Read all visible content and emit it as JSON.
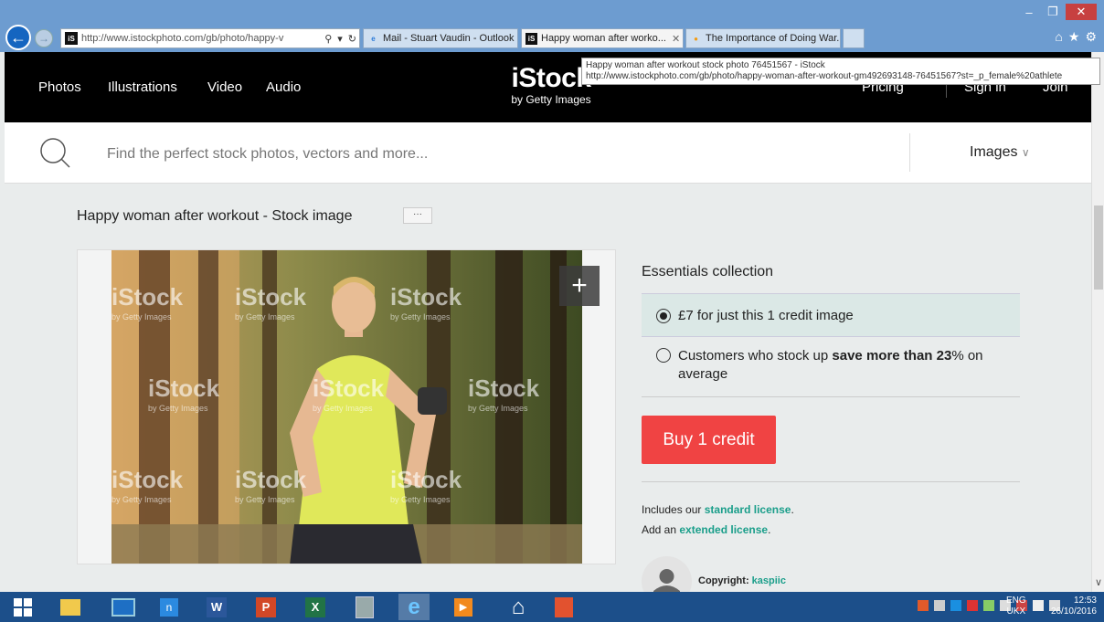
{
  "browser": {
    "address_url": "http://www.istockphoto.com/gb/photo/happy-v",
    "tabs": [
      {
        "title": "Mail - Stuart Vaudin - Outlook",
        "active": false
      },
      {
        "title": "Happy woman after worko...",
        "active": true
      },
      {
        "title": "The Importance of Doing War...",
        "active": false
      }
    ],
    "tooltip_line1": "Happy woman after workout stock photo 76451567 - iStock",
    "tooltip_line2": "http://www.istockphoto.com/gb/photo/happy-woman-after-workout-gm492693148-76451567?st=_p_female%20athlete",
    "favicon_text": "iS"
  },
  "nav": {
    "links": [
      "Photos",
      "Illustrations",
      "Video",
      "Audio"
    ],
    "logo_main": "iStock",
    "logo_sub": "by Getty Images",
    "right_links": [
      "Pricing",
      "Sign in",
      "Join"
    ]
  },
  "search": {
    "placeholder": "Find the perfect stock photos, vectors and more...",
    "dropdown_label": "Images"
  },
  "content": {
    "title": "Happy woman after workout - Stock image",
    "more_label": "···",
    "watermark_main": "iStock",
    "watermark_sub": "by Getty Images",
    "zoom_label": "+"
  },
  "purchase": {
    "collection_title": "Essentials collection",
    "option1": "£7 for just this 1 credit image",
    "option2_pre": "Customers who stock up ",
    "option2_bold": "save more than 23",
    "option2_post": "% on average",
    "buy_label": "Buy 1 credit",
    "license_line1_pre": "Includes our ",
    "license_line1_link": "standard license",
    "license_line1_post": ".",
    "license_line2_pre": "Add an ",
    "license_line2_link": "extended license",
    "license_line2_post": ".",
    "copyright_label": "Copyright: ",
    "copyright_owner": "kaspiic"
  },
  "taskbar": {
    "lang_line1": "ENG",
    "lang_line2": "UKX",
    "time": "12:53",
    "date": "26/10/2016"
  },
  "colors": {
    "buy_button": "#f04343",
    "accent_link": "#1a9e8a",
    "nav_bg": "#000000",
    "taskbar_bg": "#1c4f8a"
  }
}
